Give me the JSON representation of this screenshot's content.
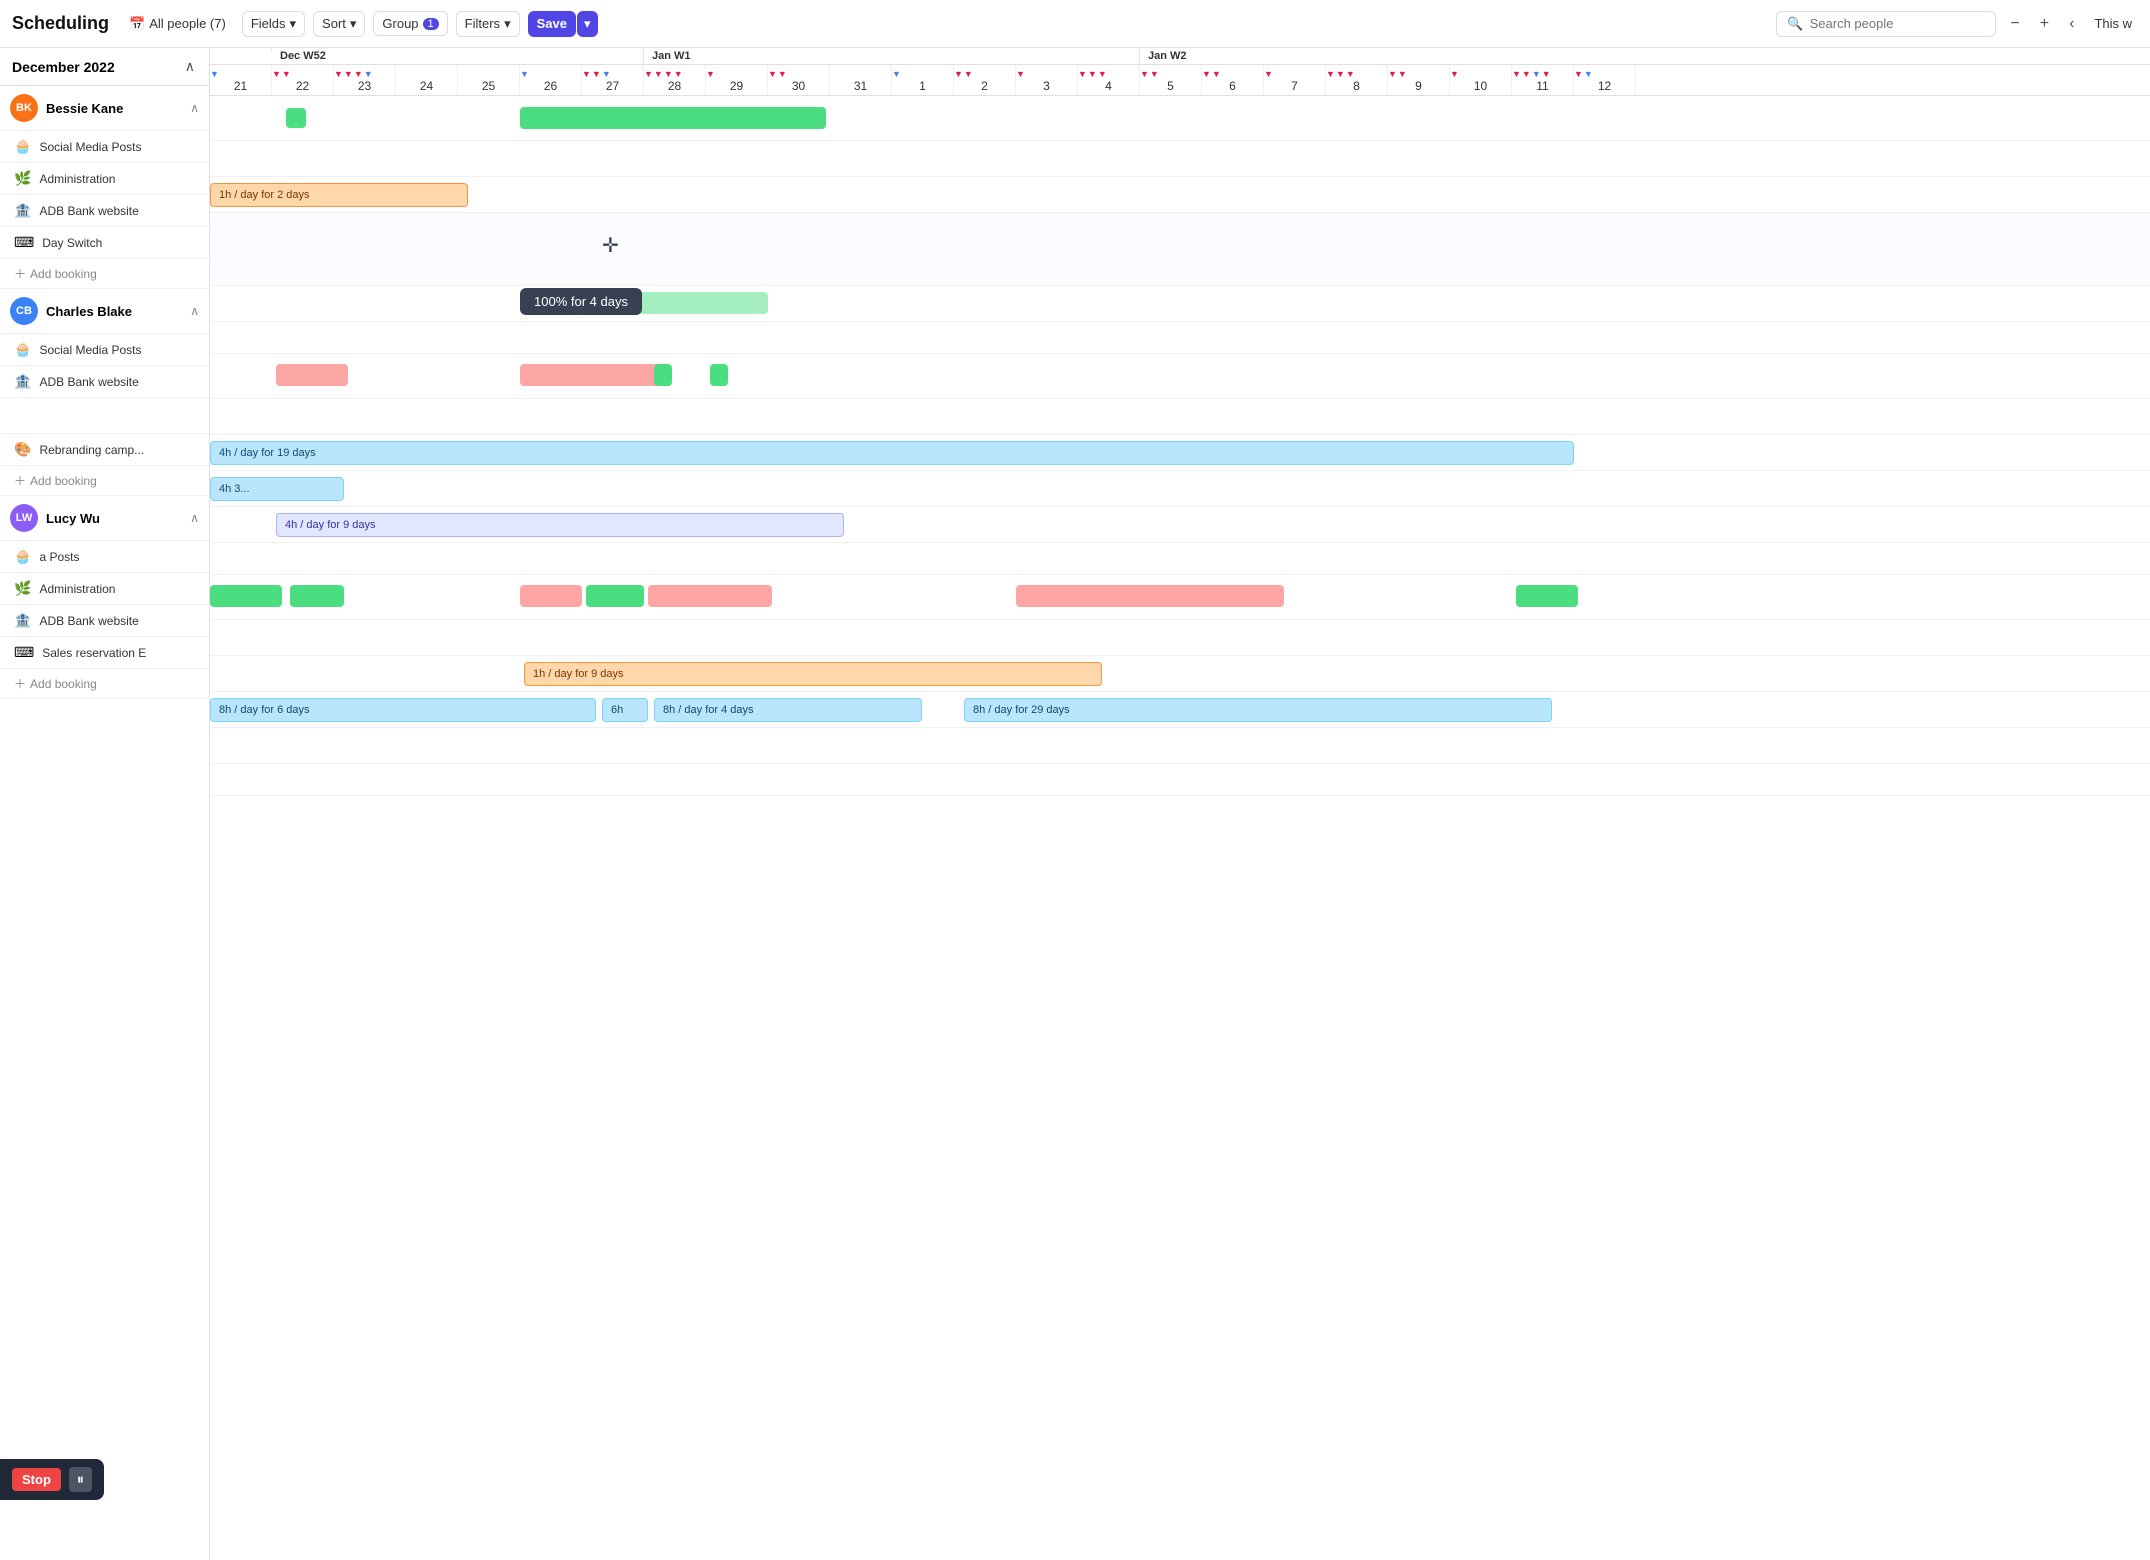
{
  "toolbar": {
    "title": "Scheduling",
    "calendar_label": "All people (7)",
    "fields_label": "Fields",
    "sort_label": "Sort",
    "group_label": "Group",
    "group_count": "1",
    "filters_label": "Filters",
    "save_label": "Save",
    "search_placeholder": "Search people",
    "this_w_label": "This w",
    "zoom_in": "+",
    "zoom_out": "−"
  },
  "date_header": {
    "month": "December 2022",
    "weeks": [
      {
        "label": "Dec W52",
        "days": [
          "26",
          "27",
          "28",
          "29",
          "30",
          "31"
        ]
      },
      {
        "label": "Jan W1",
        "days": [
          "1",
          "2",
          "3",
          "4",
          "5",
          "6",
          "7",
          "8"
        ]
      },
      {
        "label": "Jan W2",
        "days": [
          "9",
          "10",
          "11",
          "12"
        ]
      }
    ],
    "all_days": [
      "21",
      "22",
      "23",
      "24",
      "25",
      "26",
      "27",
      "28",
      "29",
      "30",
      "31",
      "1",
      "2",
      "3",
      "4",
      "5",
      "6",
      "7",
      "8",
      "9",
      "10",
      "11",
      "12"
    ]
  },
  "people": [
    {
      "id": "bessie",
      "name": "Bessie Kane",
      "avatar_initials": "BK",
      "avatar_class": "av-bessie",
      "collapsed": false,
      "tasks": [
        {
          "name": "Social Media Posts",
          "emoji": "🧁"
        },
        {
          "name": "Administration",
          "emoji": "🌿"
        },
        {
          "name": "ADB Bank website",
          "emoji": "🏦"
        },
        {
          "name": "Day Switch",
          "emoji": "⌨"
        }
      ]
    },
    {
      "id": "charles",
      "name": "Charles Blake",
      "avatar_initials": "CB",
      "avatar_class": "av-charles",
      "collapsed": false,
      "tasks": [
        {
          "name": "Social Media Posts",
          "emoji": "🧁"
        },
        {
          "name": "ADB Bank website",
          "emoji": "🏦"
        },
        {
          "name": "Rebranding camp...",
          "emoji": "🎨"
        }
      ]
    },
    {
      "id": "lucy",
      "name": "Lucy Wu",
      "avatar_initials": "LW",
      "avatar_class": "av-lucy",
      "collapsed": false,
      "tasks": [
        {
          "name": "a Posts",
          "emoji": "🧁"
        },
        {
          "name": "Administration",
          "emoji": "🌿"
        },
        {
          "name": "ADB Bank website",
          "emoji": "🏦"
        },
        {
          "name": "Sales reservation",
          "emoji": "⌨"
        }
      ]
    }
  ],
  "bookings": {
    "tooltip": "100% for 4 days",
    "bessie_social": "small green bars",
    "bessie_admin": "1h / day for 2 days",
    "charles_adb": "4h / day for 19 days",
    "charles_adb2": "4h 3...",
    "charles_rebrand": "4h / day for 9 days",
    "lucy_admin": "1h / day for 9 days",
    "lucy_adb1": "8h / day for 6 days",
    "lucy_adb2": "6h",
    "lucy_adb3": "8h / day for 4 days",
    "lucy_adb4": "8h / day for 29 days"
  },
  "stop_recording": {
    "stop_label": "Stop",
    "pause_label": "⏸"
  },
  "sidebar_bottom": {
    "sales_label": "Sales reservation E"
  }
}
